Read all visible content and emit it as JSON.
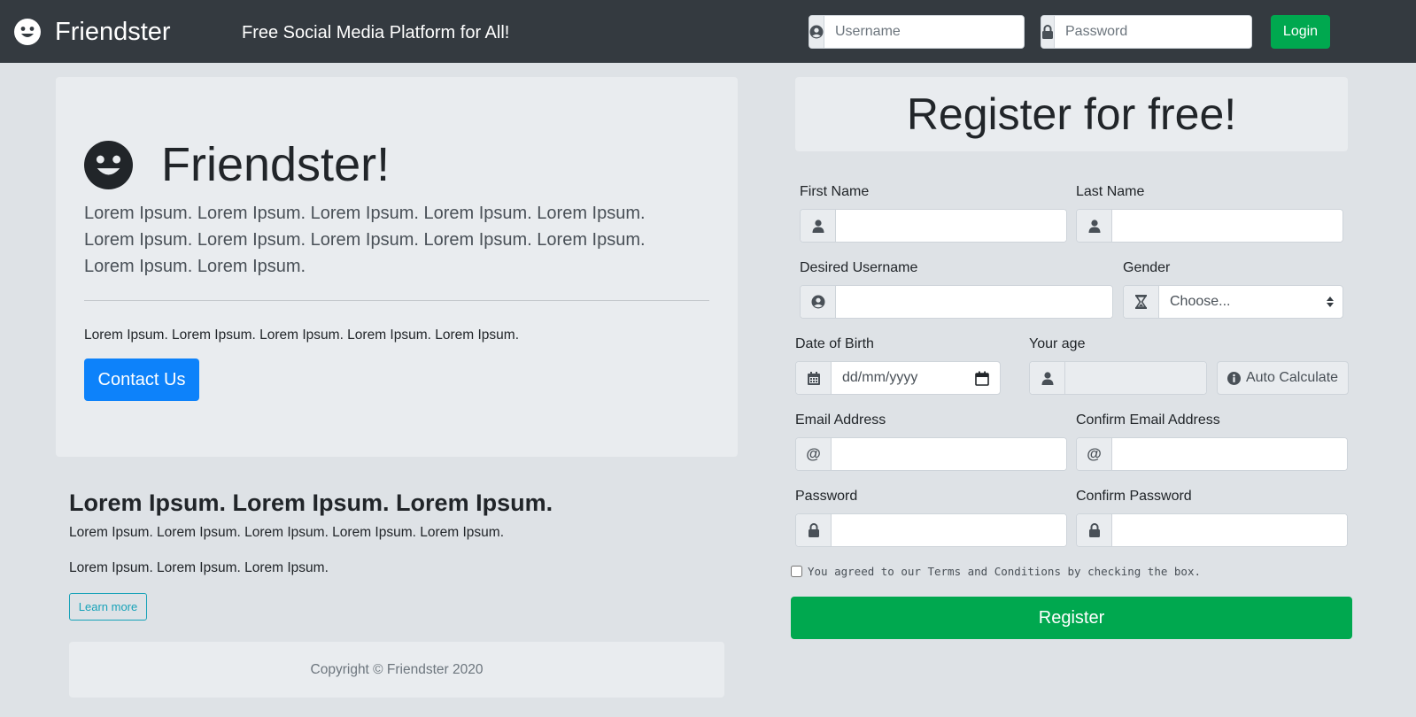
{
  "navbar": {
    "brand": "Friendster",
    "tagline": "Free Social Media Platform for All!",
    "username_placeholder": "Username",
    "password_placeholder": "Password",
    "login_label": "Login",
    "bg_color": "#343a40",
    "login_color": "#00a84f"
  },
  "jumbotron": {
    "title": "Friendster!",
    "lead": "Lorem Ipsum. Lorem Ipsum. Lorem Ipsum. Lorem Ipsum. Lorem Ipsum. Lorem Ipsum. Lorem Ipsum. Lorem Ipsum. Lorem Ipsum. Lorem Ipsum. Lorem Ipsum. Lorem Ipsum.",
    "text": "Lorem Ipsum. Lorem Ipsum. Lorem Ipsum. Lorem Ipsum. Lorem Ipsum.",
    "contact_label": "Contact Us",
    "contact_color": "#0d82fa"
  },
  "lower": {
    "heading": "Lorem Ipsum. Lorem Ipsum. Lorem Ipsum.",
    "p1": "Lorem Ipsum. Lorem Ipsum. Lorem Ipsum. Lorem Ipsum. Lorem Ipsum.",
    "p2": "Lorem Ipsum. Lorem Ipsum. Lorem Ipsum.",
    "learn_more_label": "Learn more"
  },
  "footer": {
    "copyright": "Copyright © Friendster 2020"
  },
  "register": {
    "title": "Register for free!",
    "first_name_label": "First Name",
    "last_name_label": "Last Name",
    "username_label": "Desired Username",
    "gender_label": "Gender",
    "gender_value": "Choose...",
    "dob_label": "Date of Birth",
    "dob_placeholder": "dd/mm/yyyy",
    "age_label": "Your age",
    "auto_calc_label": "Auto Calculate",
    "email_label": "Email Address",
    "confirm_email_label": "Confirm Email Address",
    "password_label": "Password",
    "confirm_password_label": "Confirm Password",
    "at_symbol": "@",
    "terms_text": "You agreed to our Terms and Conditions by checking the box.",
    "register_label": "Register",
    "register_color": "#00a84f"
  },
  "icons": {
    "brand": "smiley-icon",
    "user_circle": "user-circle-icon",
    "user": "user-icon",
    "lock": "lock-icon",
    "hourglass": "hourglass-icon",
    "calendar": "calendar-icon",
    "info": "info-circle-icon"
  }
}
